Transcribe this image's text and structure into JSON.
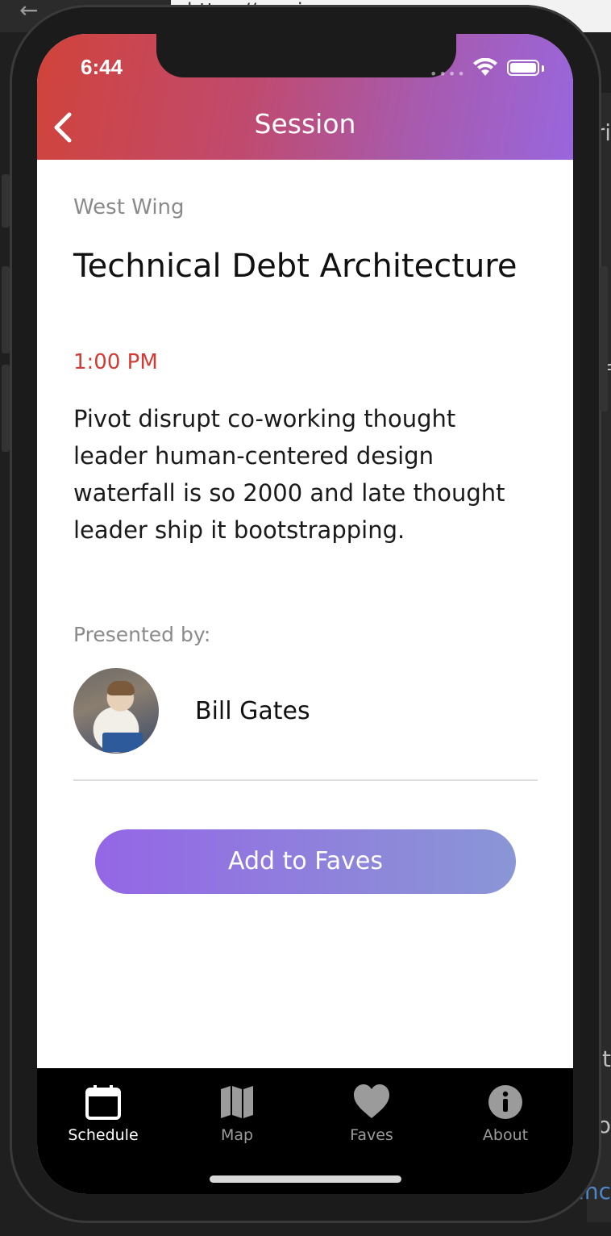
{
  "browser": {
    "url_text": "https://...ecin",
    "side_text": [
      "ri",
      "f",
      "t",
      "o",
      "anc"
    ]
  },
  "status_bar": {
    "time": "6:44"
  },
  "header": {
    "title": "Session",
    "back_icon": "chevron-left-icon"
  },
  "session": {
    "location": "West Wing",
    "title": "Technical Debt Architecture",
    "time": "1:00 PM",
    "description": "Pivot disrupt co-working thought leader human-centered design waterfall is so 2000 and late thought leader ship it bootstrapping.",
    "presented_by_label": "Presented by:",
    "speaker": {
      "name": "Bill Gates"
    }
  },
  "actions": {
    "add_to_faves_label": "Add to Faves"
  },
  "tabs": [
    {
      "label": "Schedule",
      "icon": "calendar-icon",
      "active": true
    },
    {
      "label": "Map",
      "icon": "map-icon",
      "active": false
    },
    {
      "label": "Faves",
      "icon": "heart-icon",
      "active": false
    },
    {
      "label": "About",
      "icon": "info-icon",
      "active": false
    }
  ],
  "colors": {
    "header_gradient_start": "#d1433a",
    "header_gradient_end": "#9966dd",
    "time_accent": "#d23b33",
    "button_gradient_start": "#9466e6",
    "button_gradient_end": "#8a96d6"
  }
}
